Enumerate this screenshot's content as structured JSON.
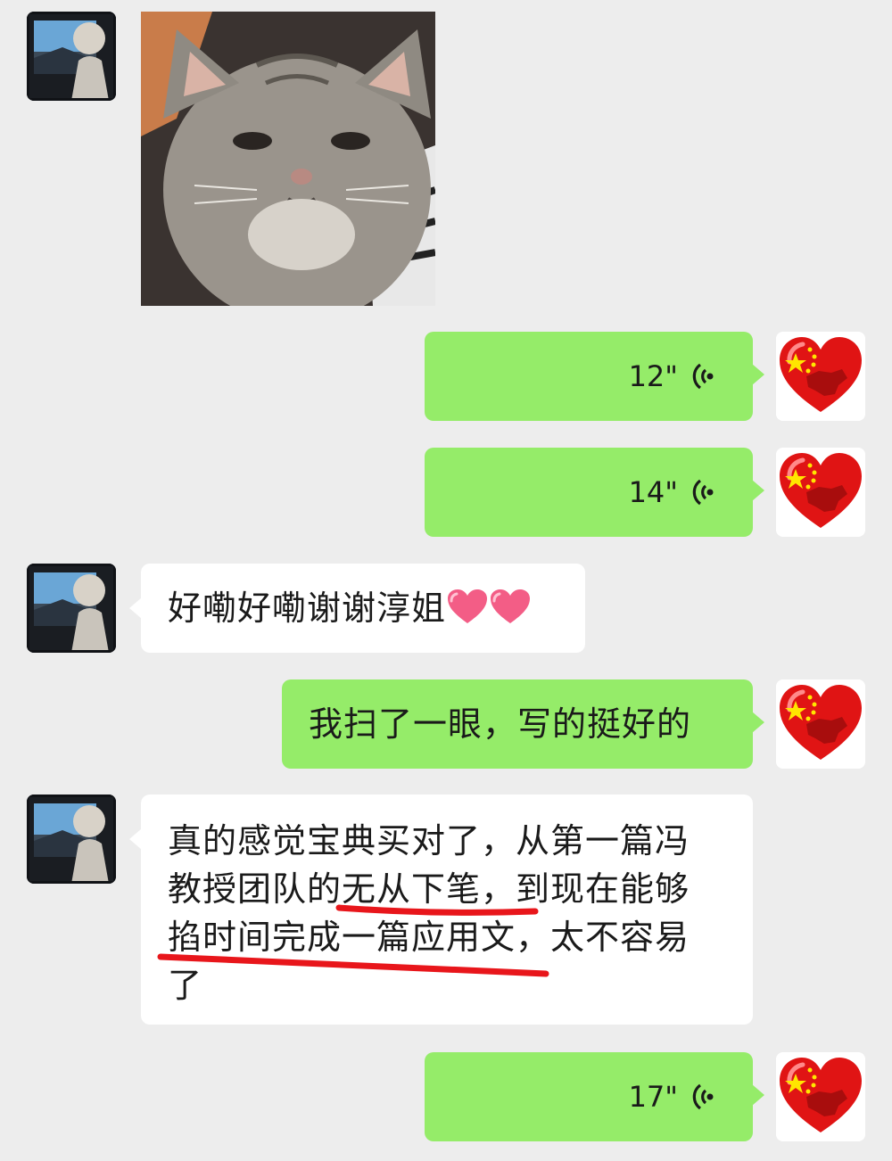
{
  "messages": [
    {
      "from": "other",
      "type": "sticker",
      "sticker": "cat-sticker"
    },
    {
      "from": "self",
      "type": "voice",
      "duration": "12\""
    },
    {
      "from": "self",
      "type": "voice",
      "duration": "14\""
    },
    {
      "from": "other",
      "type": "text",
      "text": "好嘞好嘞谢谢淳姐",
      "emoji": [
        "heart-emoji",
        "heart-emoji"
      ]
    },
    {
      "from": "self",
      "type": "text",
      "text": "我扫了一眼，写的挺好的"
    },
    {
      "from": "other",
      "type": "text",
      "lines": [
        "真的感觉宝典买对了，从第一篇冯",
        "教授团队的无从下笔，到现在能够",
        "掐时间完成一篇应用文，太不容易",
        "了"
      ]
    },
    {
      "from": "self",
      "type": "voice",
      "duration": "17\""
    }
  ],
  "colors": {
    "background": "#ededed",
    "self_bubble": "#95ec69",
    "other_bubble": "#ffffff",
    "underline": "#e8161b"
  },
  "icons": {
    "self_avatar": "china-flag-heart-icon",
    "other_avatar": "photo-avatar",
    "voice": "voice-wave-icon"
  }
}
